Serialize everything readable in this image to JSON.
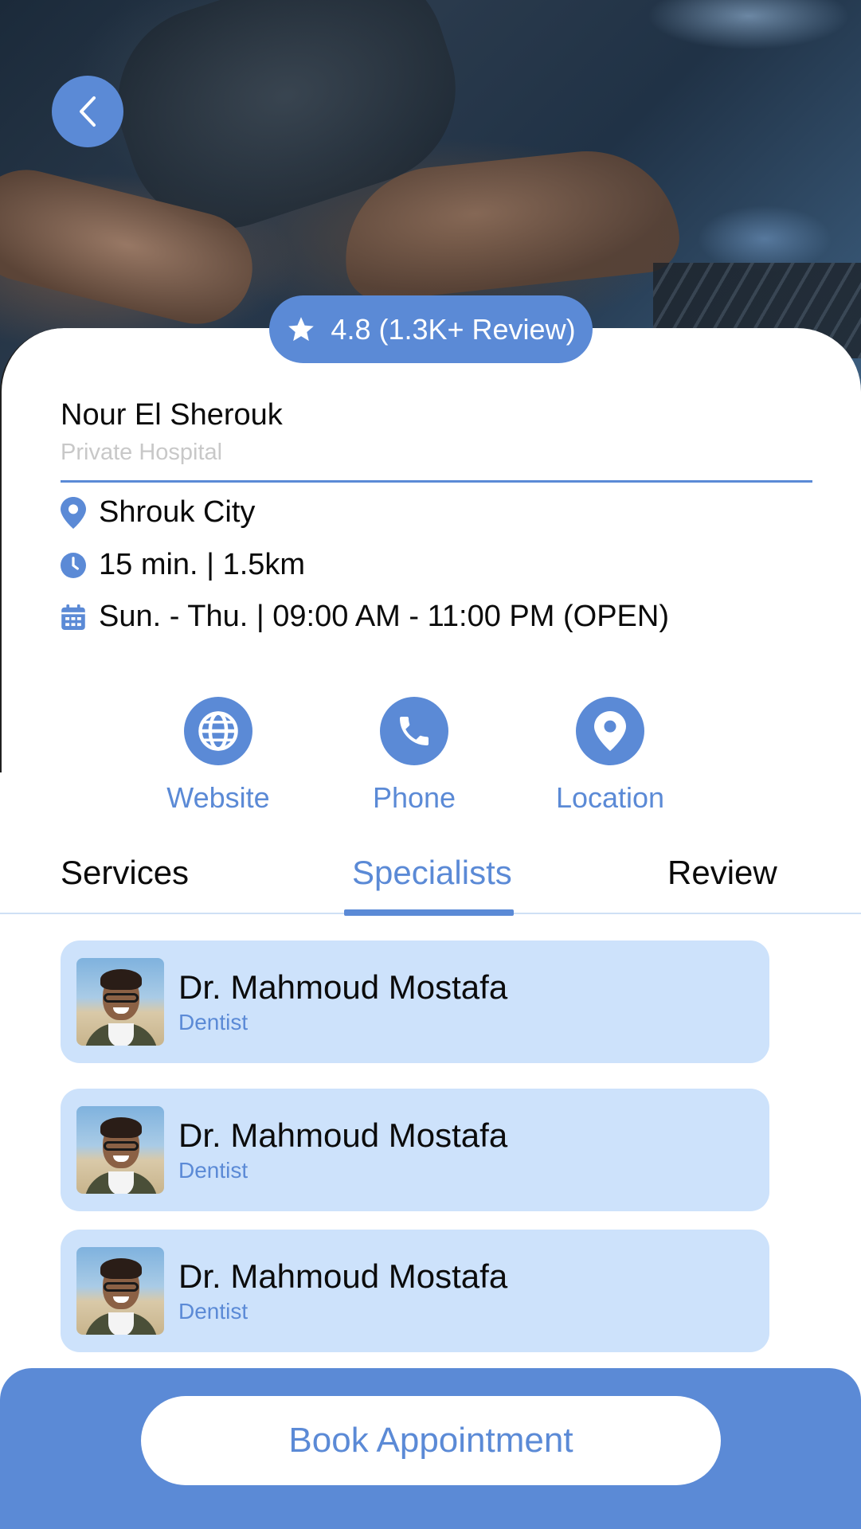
{
  "header": {
    "back_icon": "chevron-left-icon",
    "rating_icon": "star-icon",
    "rating_text": "4.8 (1.3K+ Review)"
  },
  "place": {
    "name": "Nour El Sherouk",
    "type": "Private Hospital",
    "location": "Shrouk City",
    "distance": "15 min. | 1.5km",
    "hours": "Sun. - Thu. | 09:00 AM - 11:00 PM (OPEN)"
  },
  "actions": [
    {
      "label": "Website",
      "icon": "globe-icon"
    },
    {
      "label": "Phone",
      "icon": "phone-icon"
    },
    {
      "label": "Location",
      "icon": "location-pin-icon"
    }
  ],
  "tabs": [
    {
      "label": "Services",
      "active": false
    },
    {
      "label": "Specialists",
      "active": true
    },
    {
      "label": "Review",
      "active": false
    }
  ],
  "specialists": [
    {
      "name": "Dr. Mahmoud Mostafa",
      "role": "Dentist"
    },
    {
      "name": "Dr. Mahmoud Mostafa",
      "role": "Dentist"
    },
    {
      "name": "Dr. Mahmoud Mostafa",
      "role": "Dentist"
    }
  ],
  "cta": {
    "label": "Book Appointment"
  },
  "colors": {
    "accent": "#5b8ad6",
    "card_blue": "#cde2fb",
    "muted_text": "#c8c8c8",
    "text": "#0b0b0b"
  }
}
